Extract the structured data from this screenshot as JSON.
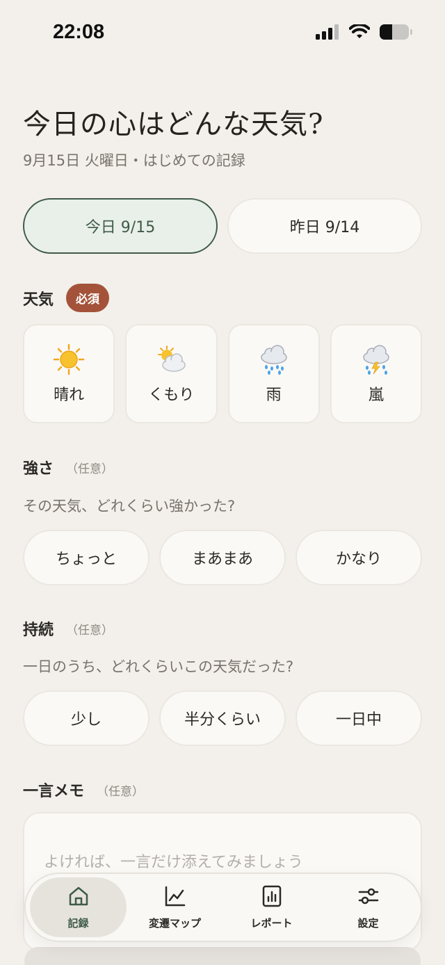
{
  "status": {
    "time": "22:08"
  },
  "header": {
    "title": "今日の心はどんな天気?",
    "subtitle": "9月15日 火曜日・はじめての記録"
  },
  "date_tabs": [
    {
      "label": "今日 9/15",
      "selected": true
    },
    {
      "label": "昨日 9/14",
      "selected": false
    }
  ],
  "weather": {
    "label": "天気",
    "required_badge": "必須",
    "options": [
      {
        "label": "晴れ",
        "icon": "sun-icon"
      },
      {
        "label": "くもり",
        "icon": "sun-behind-cloud-icon"
      },
      {
        "label": "雨",
        "icon": "rain-cloud-icon"
      },
      {
        "label": "嵐",
        "icon": "thunder-cloud-icon"
      }
    ]
  },
  "intensity": {
    "label": "強さ",
    "optional": "（任意）",
    "question": "その天気、どれくらい強かった?",
    "options": [
      "ちょっと",
      "まあまあ",
      "かなり"
    ]
  },
  "duration": {
    "label": "持続",
    "optional": "（任意）",
    "question": "一日のうち、どれくらいこの天気だった?",
    "options": [
      "少し",
      "半分くらい",
      "一日中"
    ]
  },
  "memo": {
    "label": "一言メモ",
    "optional": "（任意）",
    "placeholder": "よければ、一言だけ添えてみましょう"
  },
  "tab_bar": {
    "tabs": [
      {
        "label": "記録",
        "icon": "home-icon",
        "active": true
      },
      {
        "label": "変遷マップ",
        "icon": "line-chart-icon",
        "active": false
      },
      {
        "label": "レポート",
        "icon": "report-icon",
        "active": false
      },
      {
        "label": "設定",
        "icon": "sliders-icon",
        "active": false
      }
    ]
  },
  "colors": {
    "background": "#f3f0eb",
    "accent_green": "#3e5b47",
    "badge_red": "#a4533a"
  }
}
